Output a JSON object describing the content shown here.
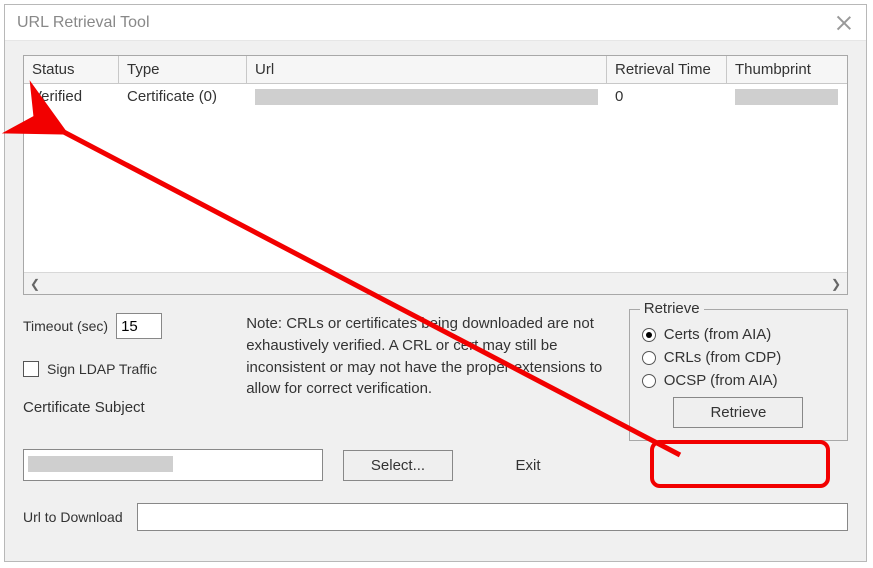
{
  "window": {
    "title": "URL Retrieval Tool"
  },
  "grid": {
    "headers": {
      "status": "Status",
      "type": "Type",
      "url": "Url",
      "rtime": "Retrieval Time",
      "thumb": "Thumbprint"
    },
    "row0": {
      "status": "Verified",
      "type": "Certificate (0)",
      "rtime": "0"
    }
  },
  "timeout": {
    "label": "Timeout (sec)",
    "value": "15"
  },
  "sign_ldap": {
    "label": "Sign LDAP Traffic"
  },
  "note": "Note: CRLs or certificates being downloaded are not exhaustively verified.  A CRL or cert may still be inconsistent or may not have the proper extensions to allow for correct verification.",
  "retrieve": {
    "legend": "Retrieve",
    "opt_certs": "Certs (from AIA)",
    "opt_crls": "CRLs (from CDP)",
    "opt_ocsp": "OCSP (from AIA)",
    "button": "Retrieve"
  },
  "cert_subject": {
    "label": "Certificate Subject"
  },
  "select_btn": "Select...",
  "exit_btn": "Exit",
  "url_dl": {
    "label": "Url to Download"
  }
}
